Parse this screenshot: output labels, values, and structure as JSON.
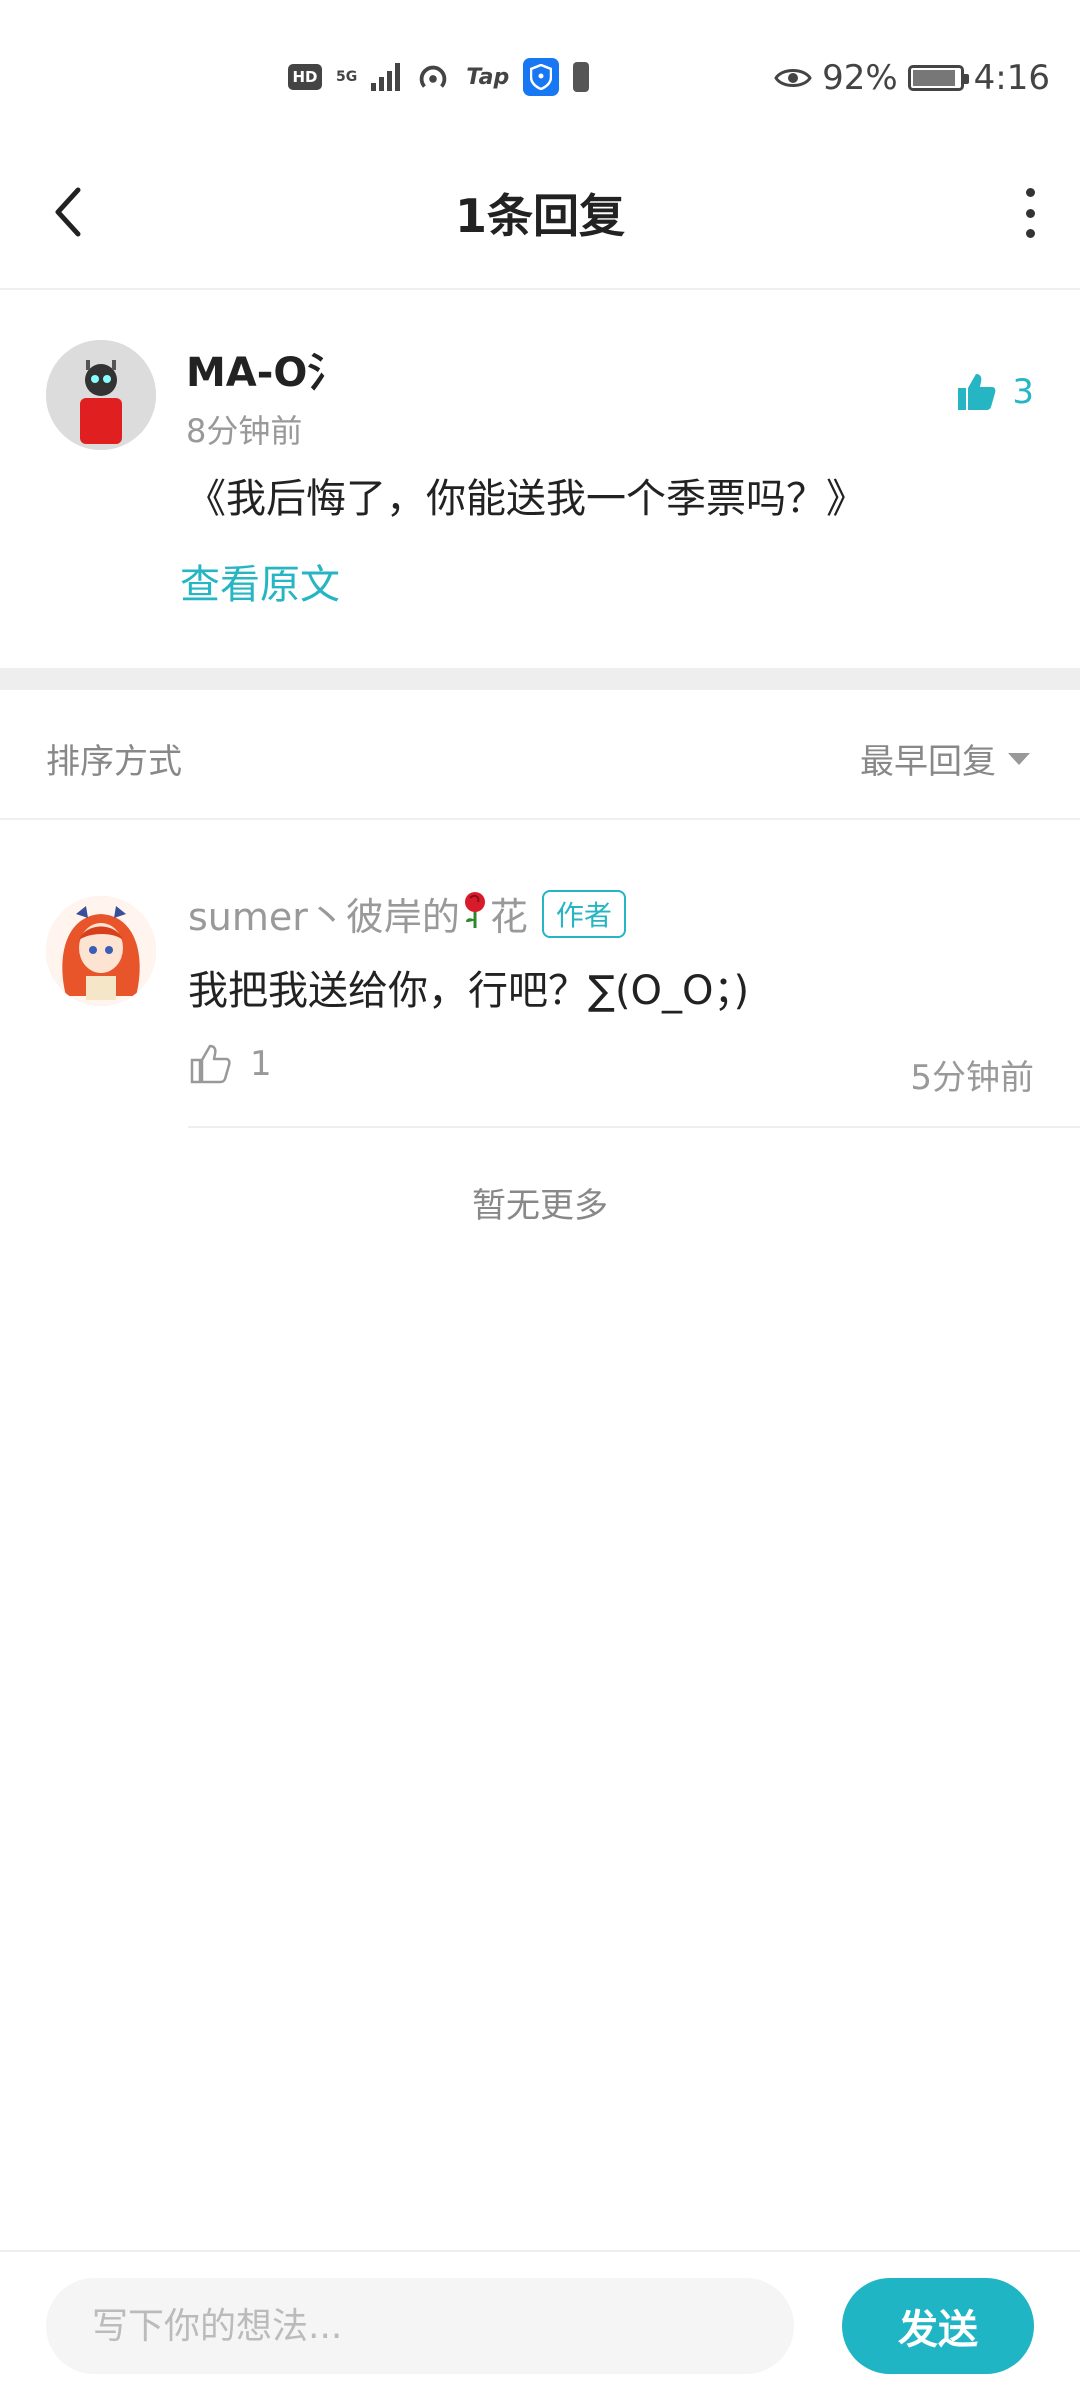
{
  "status_bar": {
    "hd_label": "HD",
    "network_label": "5G",
    "tap_label": "Tap",
    "battery_percent": "92%",
    "battery_level": 0.92,
    "time": "4:16"
  },
  "header": {
    "title": "1条回复"
  },
  "original_comment": {
    "username": "MA-O氵",
    "time": "8分钟前",
    "like_count": "3",
    "content": "《我后悔了，你能送我一个季票吗？》",
    "view_original_label": "查看原文"
  },
  "sort": {
    "label": "排序方式",
    "value": "最早回复"
  },
  "reply": {
    "username_prefix": "sumer丶彼岸的",
    "username_suffix": "花",
    "author_badge": "作者",
    "content": "我把我送给你，行吧？∑(O_O；)",
    "like_count": "1",
    "time": "5分钟前"
  },
  "no_more_label": "暂无更多",
  "composer": {
    "placeholder": "写下你的想法...",
    "send_label": "发送"
  },
  "colors": {
    "accent": "#25b5c3",
    "send_button": "#1fb5c4"
  },
  "icons": [
    "back-arrow-icon",
    "more-vertical-icon",
    "thumbs-up-icon",
    "rose-icon",
    "caret-down-icon",
    "eye-icon",
    "battery-icon",
    "hotspot-icon",
    "shield-icon"
  ]
}
